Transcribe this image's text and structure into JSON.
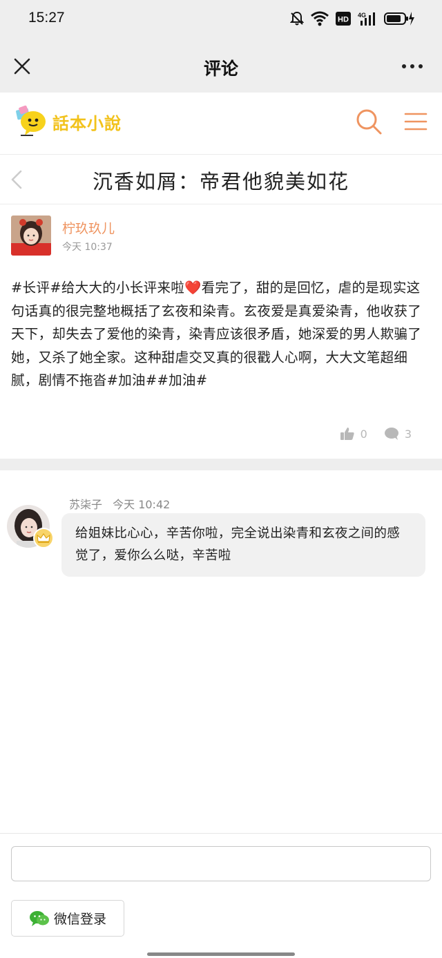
{
  "status_bar": {
    "time": "15:27",
    "hd_label": "HD",
    "network_label": "4G"
  },
  "header": {
    "title": "评论"
  },
  "site": {
    "logo_text": "話本小說",
    "accent_color": "#ef9460",
    "logo_color": "#f2c21b"
  },
  "book": {
    "title": "沉香如屑：帝君他貌美如花"
  },
  "post": {
    "author": "柠玖玖儿",
    "time": "今天 10:37",
    "content": "#长评#给大大的小长评来啦❤️看完了，甜的是回忆，虐的是现实这句话真的很完整地概括了玄夜和染青。玄夜爱是真爱染青，他收获了天下，却失去了爱他的染青，染青应该很矛盾，她深爱的男人欺骗了她，又杀了她全家。这种甜虐交叉真的很戳人心啊，大大文笔超细腻，剧情不拖沓#加油##加油#",
    "likes": "0",
    "comments": "3"
  },
  "reply": {
    "author": "苏柒子",
    "time": "今天 10:42",
    "content": "给姐妹比心心，辛苦你啦，完全说出染青和玄夜之间的感觉了，爱你么么哒，辛苦啦"
  },
  "bottom": {
    "input_value": "",
    "wechat_login_label": "微信登录"
  }
}
